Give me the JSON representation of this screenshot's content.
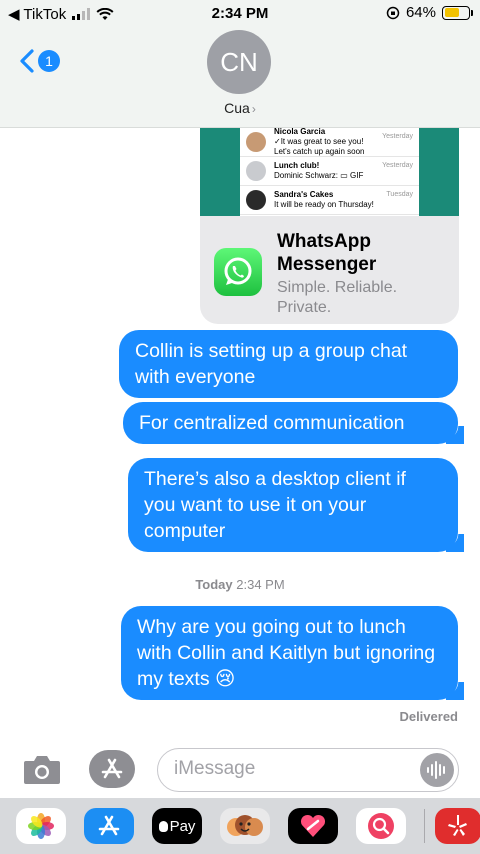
{
  "status_bar": {
    "back_app": "◀ TikTok",
    "time": "2:34 PM",
    "battery": "64%",
    "battery_level": 0.64
  },
  "header": {
    "unread_count": "1",
    "avatar_initials": "CN",
    "contact_name": "Cua"
  },
  "link_preview": {
    "preview_rows": [
      {
        "name": "Nicola Garcia",
        "text": "✓It was great to see you! Let's catch up again soon",
        "time": "Yesterday"
      },
      {
        "name": "Lunch club!",
        "text": "Dominic Schwarz: ▭ GIF",
        "time": "Yesterday"
      },
      {
        "name": "Sandra's Cakes",
        "text": "It will be ready on Thursday!",
        "time": "Tuesday"
      }
    ],
    "title": "WhatsApp Messenger",
    "subtitle": "Simple. Reliable. Private."
  },
  "messages": [
    {
      "text": "Collin is setting up a group chat with everyone"
    },
    {
      "text": "For centralized communication"
    },
    {
      "text": "There’s also a desktop client if you want to use it on your computer"
    },
    {
      "text": "Why are you going out to lunch with Collin and Kaitlyn but ignoring my texts 😢"
    }
  ],
  "timestamp": {
    "day": "Today",
    "time": "2:34 PM"
  },
  "delivered_label": "Delivered",
  "composer": {
    "placeholder": "iMessage"
  },
  "app_drawer": [
    {
      "icon": "photos-icon"
    },
    {
      "icon": "app-store-icon"
    },
    {
      "label": " Pay"
    },
    {
      "icon": "memoji-icon"
    },
    {
      "icon": "digital-touch-icon"
    },
    {
      "icon": "web-search-icon"
    },
    {
      "icon": "yelp-icon"
    }
  ],
  "colors": {
    "bubble_blue": "#1a8cff",
    "header_bg": "#f1f4f2",
    "whatsapp_green": "#1b8a78"
  }
}
